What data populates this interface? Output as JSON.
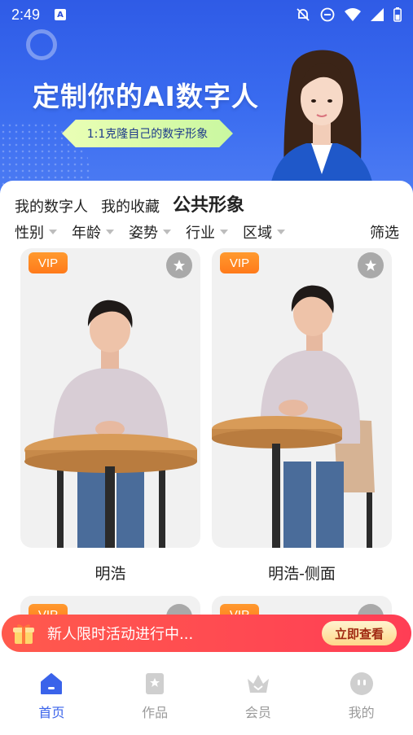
{
  "status_bar": {
    "time": "2:49",
    "notif_icon": "a-icon"
  },
  "banner": {
    "title": "定制你的AI数字人",
    "pill": "1:1克隆自己的数字形象"
  },
  "tabs": [
    {
      "label": "我的数字人",
      "active": false
    },
    {
      "label": "我的收藏",
      "active": false
    },
    {
      "label": "公共形象",
      "active": true
    }
  ],
  "filters": [
    {
      "label": "性别"
    },
    {
      "label": "年龄"
    },
    {
      "label": "姿势"
    },
    {
      "label": "行业"
    },
    {
      "label": "区域"
    }
  ],
  "filter_screen": "筛选",
  "cards": [
    {
      "badge": "VIP",
      "name": "明浩"
    },
    {
      "badge": "VIP",
      "name": "明浩-侧面"
    },
    {
      "badge": "VIP"
    },
    {
      "badge": "VIP"
    }
  ],
  "promo": {
    "text": "新人限时活动进行中...",
    "button": "立即查看"
  },
  "bottom_nav": [
    {
      "label": "首页",
      "icon": "home-icon",
      "active": true
    },
    {
      "label": "作品",
      "icon": "works-icon",
      "active": false
    },
    {
      "label": "会员",
      "icon": "vip-crown-icon",
      "active": false
    },
    {
      "label": "我的",
      "icon": "profile-icon",
      "active": false
    }
  ],
  "colors": {
    "primary": "#3a63ea",
    "vip": "#ff7a1a",
    "promo": "#ff4a50"
  }
}
